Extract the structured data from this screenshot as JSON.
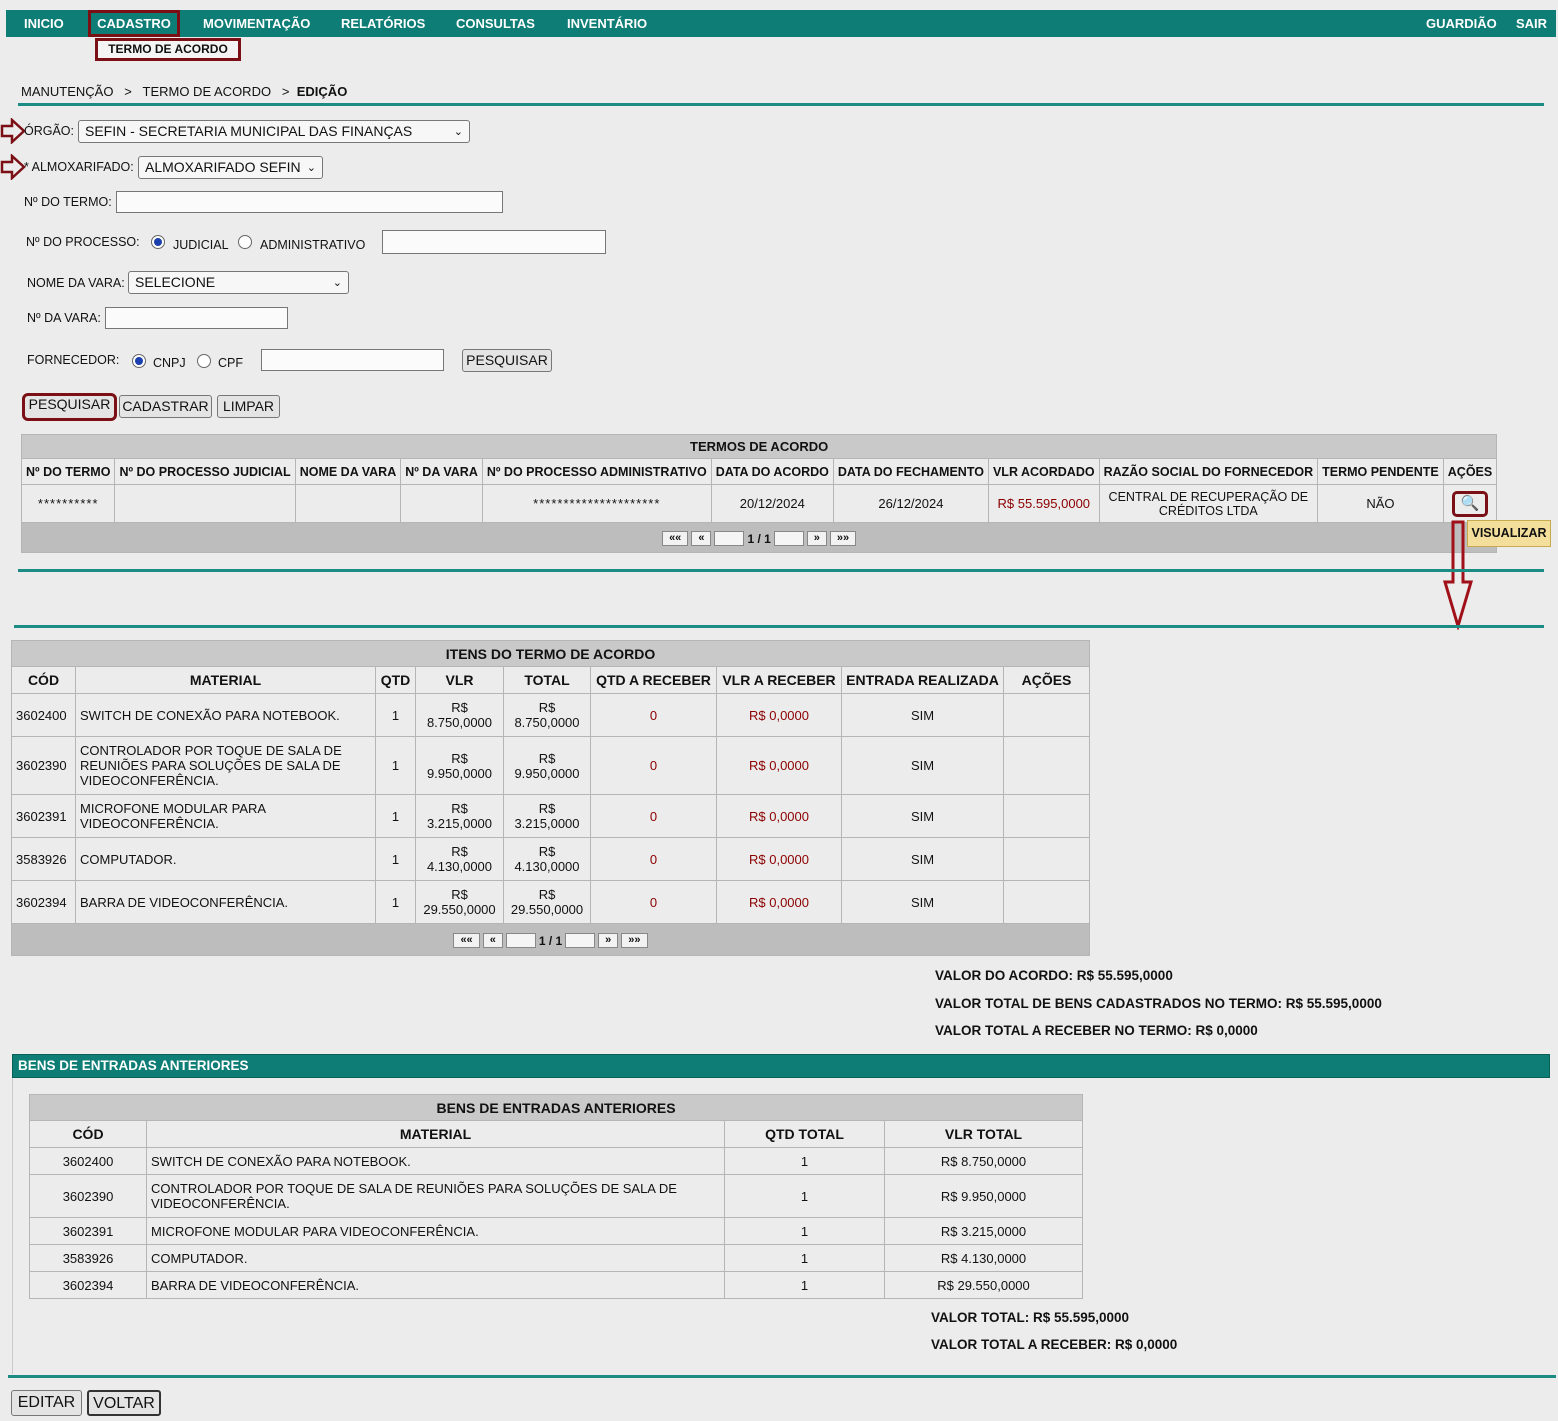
{
  "nav": {
    "items": [
      "INICIO",
      "CADASTRO",
      "MOVIMENTAÇÃO",
      "RELATÓRIOS",
      "CONSULTAS",
      "INVENTÁRIO"
    ],
    "right": [
      "GUARDIÃO",
      "SAIR"
    ],
    "submenu": "TERMO DE ACORDO"
  },
  "breadcrumb": {
    "a": "MANUTENÇÃO",
    "b": "TERMO DE ACORDO",
    "c": "EDIÇÃO",
    "sep": ">"
  },
  "form": {
    "orgao_label": "ÓRGÃO:",
    "orgao_value": "SEFIN - SECRETARIA MUNICIPAL DAS FINANÇAS",
    "almox_label": "* ALMOXARIFADO:",
    "almox_value": "ALMOXARIFADO SEFIN",
    "termo_label": "Nº DO TERMO:",
    "processo_label": "Nº DO PROCESSO:",
    "processo_opt1": "JUDICIAL",
    "processo_opt2": "ADMINISTRATIVO",
    "vara_label": "NOME DA VARA:",
    "vara_value": "SELECIONE",
    "nvara_label": "Nº DA VARA:",
    "fornecedor_label": "FORNECEDOR:",
    "forn_opt1": "CNPJ",
    "forn_opt2": "CPF",
    "pesquisar_small": "PESQUISAR"
  },
  "actions": {
    "pesquisar": "PESQUISAR",
    "cadastrar": "CADASTRAR",
    "limpar": "LIMPAR"
  },
  "termos": {
    "caption": "TERMOS DE ACORDO",
    "headers": [
      "Nº DO TERMO",
      "Nº DO PROCESSO JUDICIAL",
      "NOME DA VARA",
      "Nº DA VARA",
      "Nº DO PROCESSO ADMINISTRATIVO",
      "DATA DO ACORDO",
      "DATA DO FECHAMENTO",
      "VLR ACORDADO",
      "RAZÃO SOCIAL DO FORNECEDOR",
      "TERMO PENDENTE",
      "AÇÕES"
    ],
    "row": {
      "termo": "**********",
      "proc_jud": "",
      "vara": "",
      "nvara": "",
      "proc_adm": "*********************",
      "data_acordo": "20/12/2024",
      "data_fech": "26/12/2024",
      "vlr": "R$ 55.595,0000",
      "razao": "CENTRAL DE RECUPERAÇÃO DE CRÉDITOS LTDA",
      "pendente": "NÃO"
    },
    "tooltip": "VISUALIZAR",
    "pager": {
      "first": "««",
      "prev": "«",
      "page": "1 / 1",
      "next": "»",
      "last": "»»"
    }
  },
  "itens": {
    "caption": "ITENS DO TERMO DE ACORDO",
    "headers": [
      "CÓD",
      "MATERIAL",
      "QTD",
      "VLR",
      "TOTAL",
      "QTD A RECEBER",
      "VLR A RECEBER",
      "ENTRADA REALIZADA",
      "AÇÕES"
    ],
    "rows": [
      {
        "cod": "3602400",
        "material": "SWITCH DE CONEXÃO PARA NOTEBOOK.",
        "qtd": "1",
        "vlr_a": "R$",
        "vlr_b": "8.750,0000",
        "tot_a": "R$",
        "tot_b": "8.750,0000",
        "qtd_rec": "0",
        "vlr_rec": "R$ 0,0000",
        "entrada": "SIM"
      },
      {
        "cod": "3602390",
        "material": "CONTROLADOR POR TOQUE DE SALA DE REUNIÕES PARA SOLUÇÕES DE SALA DE VIDEOCONFERÊNCIA.",
        "qtd": "1",
        "vlr_a": "R$",
        "vlr_b": "9.950,0000",
        "tot_a": "R$",
        "tot_b": "9.950,0000",
        "qtd_rec": "0",
        "vlr_rec": "R$ 0,0000",
        "entrada": "SIM"
      },
      {
        "cod": "3602391",
        "material": "MICROFONE MODULAR PARA VIDEOCONFERÊNCIA.",
        "qtd": "1",
        "vlr_a": "R$",
        "vlr_b": "3.215,0000",
        "tot_a": "R$",
        "tot_b": "3.215,0000",
        "qtd_rec": "0",
        "vlr_rec": "R$ 0,0000",
        "entrada": "SIM"
      },
      {
        "cod": "3583926",
        "material": "COMPUTADOR.",
        "qtd": "1",
        "vlr_a": "R$",
        "vlr_b": "4.130,0000",
        "tot_a": "R$",
        "tot_b": "4.130,0000",
        "qtd_rec": "0",
        "vlr_rec": "R$ 0,0000",
        "entrada": "SIM"
      },
      {
        "cod": "3602394",
        "material": "BARRA DE VIDEOCONFERÊNCIA.",
        "qtd": "1",
        "vlr_a": "R$",
        "vlr_b": "29.550,0000",
        "tot_a": "R$",
        "tot_b": "29.550,0000",
        "qtd_rec": "0",
        "vlr_rec": "R$ 0,0000",
        "entrada": "SIM"
      }
    ],
    "pager": {
      "first": "««",
      "prev": "«",
      "page": "1 / 1",
      "next": "»",
      "last": "»»"
    }
  },
  "summary1": {
    "valor_acordo": "VALOR DO ACORDO: R$ 55.595,0000",
    "valor_bens": "VALOR TOTAL DE BENS CADASTRADOS NO TERMO: R$ 55.595,0000",
    "valor_receber": "VALOR TOTAL A RECEBER NO TERMO: R$ 0,0000"
  },
  "bens": {
    "bar_title": "BENS DE ENTRADAS ANTERIORES",
    "caption": "BENS DE ENTRADAS ANTERIORES",
    "headers": [
      "CÓD",
      "MATERIAL",
      "QTD TOTAL",
      "VLR TOTAL"
    ],
    "rows": [
      {
        "cod": "3602400",
        "material": "SWITCH DE CONEXÃO PARA NOTEBOOK.",
        "qtd": "1",
        "vlr": "R$ 8.750,0000"
      },
      {
        "cod": "3602390",
        "material": "CONTROLADOR POR TOQUE DE SALA DE REUNIÕES PARA SOLUÇÕES DE SALA DE VIDEOCONFERÊNCIA.",
        "qtd": "1",
        "vlr": "R$ 9.950,0000"
      },
      {
        "cod": "3602391",
        "material": "MICROFONE MODULAR PARA VIDEOCONFERÊNCIA.",
        "qtd": "1",
        "vlr": "R$ 3.215,0000"
      },
      {
        "cod": "3583926",
        "material": "COMPUTADOR.",
        "qtd": "1",
        "vlr": "R$ 4.130,0000"
      },
      {
        "cod": "3602394",
        "material": "BARRA DE VIDEOCONFERÊNCIA.",
        "qtd": "1",
        "vlr": "R$ 29.550,0000"
      }
    ],
    "valor_total": "VALOR TOTAL: R$ 55.595,0000",
    "valor_receber": "VALOR TOTAL A RECEBER: R$ 0,0000"
  },
  "footer": {
    "editar": "EDITAR",
    "voltar": "VOLTAR"
  },
  "colors": {
    "teal": "#0e7d76",
    "highlight": "#7a1016",
    "value_red": "#8b0000",
    "tooltip": "#f3df9b"
  },
  "icons": {
    "view": "magnifier-icon",
    "marker": "outline-arrow-right-icon",
    "down": "outline-arrow-down-icon"
  }
}
